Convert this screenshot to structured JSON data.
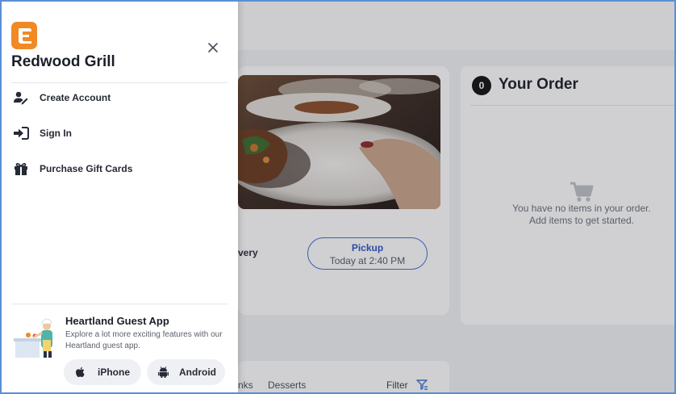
{
  "drawer": {
    "brand_name": "Redwood Grill",
    "menu": [
      {
        "label": "Create Account",
        "icon": "user-plus-icon"
      },
      {
        "label": "Sign In",
        "icon": "sign-in-icon"
      },
      {
        "label": "Purchase Gift Cards",
        "icon": "gift-icon"
      }
    ],
    "promo": {
      "title": "Heartland Guest App",
      "description": "Explore a lot more exciting features with our Heartland guest app.",
      "buttons": [
        {
          "label": "iPhone",
          "icon": "apple-icon"
        },
        {
          "label": "Android",
          "icon": "android-icon"
        }
      ]
    }
  },
  "background": {
    "order_mode": {
      "delivery_partial": "very",
      "pickup_title": "Pickup",
      "pickup_time": "Today at 2:40 PM"
    },
    "order": {
      "count": "0",
      "title": "Your Order",
      "empty_line1": "You have no items in your order.",
      "empty_line2": "Add items to get started."
    },
    "categories": [
      "nks",
      "Desserts"
    ],
    "filter_label": "Filter"
  },
  "colors": {
    "brand_orange": "#f08a24",
    "accent_blue": "#2d57c3",
    "frame_blue": "#5b8fd6"
  }
}
